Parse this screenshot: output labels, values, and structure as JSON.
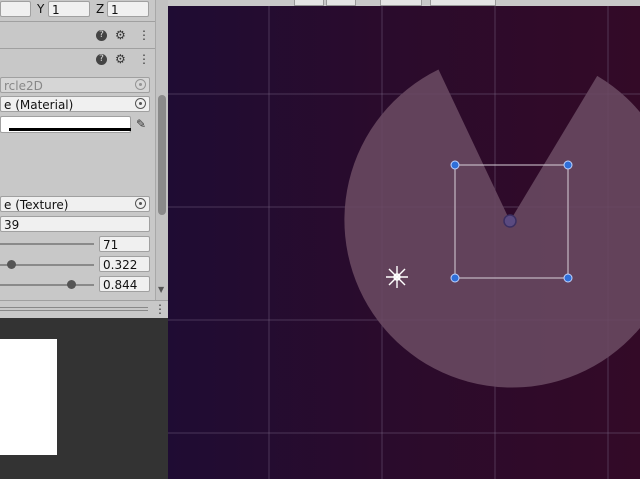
{
  "transform": {
    "y_label": "Y",
    "y_value": "1",
    "z_label": "Z",
    "z_value": "1"
  },
  "component_circle": {
    "name": "rcle2D"
  },
  "material": {
    "value": "e (Material)"
  },
  "texture": {
    "value": "e (Texture)"
  },
  "fields": {
    "partial_value": "39",
    "int_value": "71",
    "slider1_value": "0.322",
    "slider2_value": "0.844"
  },
  "icons": {
    "help": "help-icon",
    "settings": "sliders-icon",
    "menu": "kebab-menu-icon",
    "picker": "object-picker-icon",
    "eyedropper": "eyedropper-icon",
    "light": "light-gizmo-icon"
  },
  "colors": {
    "inspector_bg": "#c8c8c8",
    "scene_bg_left": "#1f0c33",
    "scene_bg_right": "#330a27",
    "light_shape": "#6a4a62",
    "handle_blue": "#2f6fd8"
  },
  "light_shape": {
    "sector_gap_degrees": 60
  }
}
